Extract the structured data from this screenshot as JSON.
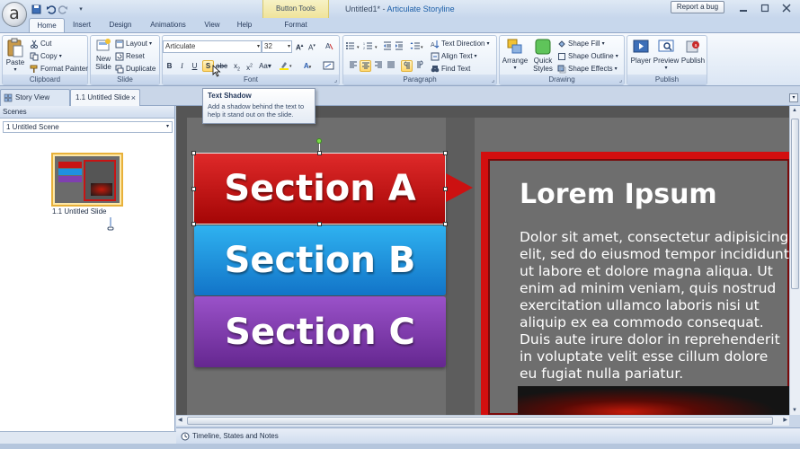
{
  "window": {
    "doc_name": "Untitled1*",
    "separator": " - ",
    "app_name": "Articulate Storyline",
    "contextual_group": "Button Tools",
    "report_bug": "Report a bug"
  },
  "tabs": [
    {
      "label": "Home",
      "active": true
    },
    {
      "label": "Insert"
    },
    {
      "label": "Design"
    },
    {
      "label": "Animations"
    },
    {
      "label": "View"
    },
    {
      "label": "Help"
    },
    {
      "label": "Format"
    }
  ],
  "ribbon": {
    "clipboard": {
      "label": "Clipboard",
      "paste": "Paste",
      "cut": "Cut",
      "copy": "Copy",
      "format_painter": "Format Painter"
    },
    "slide": {
      "label": "Slide",
      "new_slide_1": "New",
      "new_slide_2": "Slide",
      "layout": "Layout",
      "reset": "Reset",
      "duplicate": "Duplicate"
    },
    "font": {
      "label": "Font",
      "font_name": "Articulate",
      "font_size": "32"
    },
    "paragraph": {
      "label": "Paragraph",
      "text_direction": "Text Direction",
      "align_text": "Align Text",
      "find_text": "Find Text"
    },
    "drawing": {
      "label": "Drawing",
      "arrange": "Arrange",
      "quick_styles_1": "Quick",
      "quick_styles_2": "Styles",
      "shape_fill": "Shape Fill",
      "shape_outline": "Shape Outline",
      "shape_effects": "Shape Effects"
    },
    "publish": {
      "label": "Publish",
      "player": "Player",
      "preview": "Preview",
      "publish": "Publish"
    }
  },
  "tooltip": {
    "title": "Text Shadow",
    "body": "Add a shadow behind the text to help it stand out on the slide."
  },
  "doc_tabs": {
    "story_view": "Story View",
    "slide_tab": "1.1 Untitled Slide",
    "close": "×"
  },
  "scenes": {
    "header": "Scenes",
    "selected_scene": "1 Untitled Scene",
    "thumb_label": "1.1 Untitled Slide"
  },
  "slide": {
    "section_a": "Section A",
    "section_b": "Section B",
    "section_c": "Section C",
    "title": "Lorem Ipsum",
    "body": "Dolor sit amet, consectetur adipisicing elit, sed do eiusmod tempor incididunt ut labore et dolore magna aliqua. Ut enim ad minim veniam, quis nostrud exercitation ullamco laboris nisi ut aliquip ex ea commodo consequat. Duis aute irure dolor in reprehenderit in voluptate velit esse cillum dolore eu fugiat nulla pariatur."
  },
  "timeline": {
    "label": "Timeline, States and Notes"
  },
  "colors": {
    "section_a": "#c81414",
    "section_b": "#1e90e0",
    "section_c": "#7f3fb0",
    "accent": "#d30f0f"
  }
}
